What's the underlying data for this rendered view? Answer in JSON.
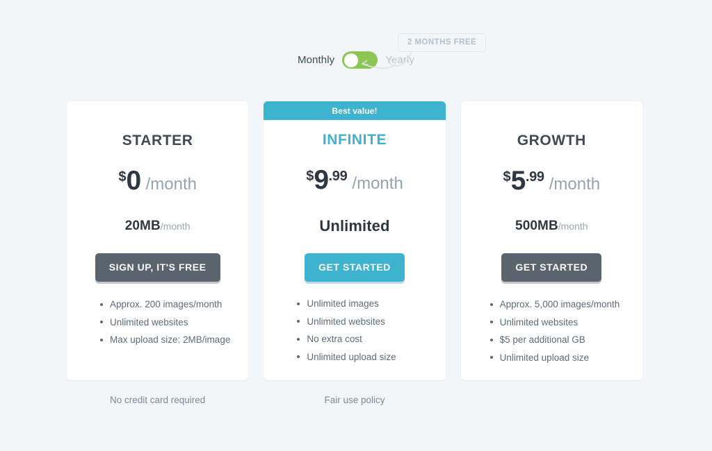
{
  "billing": {
    "monthly_label": "Monthly",
    "yearly_label": "Yearly",
    "selected": "Monthly",
    "promo_badge": "2 MONTHS FREE",
    "toggle_color": "#8cc653",
    "knob_color": "#ffffff"
  },
  "theme": {
    "page_background": "#f2f6f9",
    "accent": "#3eb3d0",
    "dark_button": "#59646f",
    "heading": "#3f4a57",
    "muted_text": "#94a3b0"
  },
  "plans": [
    {
      "id": "starter",
      "name": "STARTER",
      "ribbon": null,
      "price": {
        "currency": "$",
        "amount": "0",
        "cents": "",
        "period": "/month"
      },
      "storage": {
        "value": "20MB",
        "unit": "/month"
      },
      "cta": "SIGN UP, IT'S FREE",
      "cta_style": "dark",
      "features": [
        "Approx. 200 images/month",
        "Unlimited websites",
        "Max upload size: 2MB/image"
      ],
      "footnote": "No credit card required"
    },
    {
      "id": "infinite",
      "name": "INFINITE",
      "ribbon": "Best value!",
      "price": {
        "currency": "$",
        "amount": "9",
        "cents": ".99",
        "period": "/month"
      },
      "storage": {
        "value": "Unlimited",
        "unit": ""
      },
      "cta": "GET STARTED",
      "cta_style": "teal",
      "features": [
        "Unlimited images",
        "Unlimited websites",
        "No extra cost",
        "Unlimited upload size"
      ],
      "footnote": "Fair use policy"
    },
    {
      "id": "growth",
      "name": "GROWTH",
      "ribbon": null,
      "price": {
        "currency": "$",
        "amount": "5",
        "cents": ".99",
        "period": "/month"
      },
      "storage": {
        "value": "500MB",
        "unit": "/month"
      },
      "cta": "GET STARTED",
      "cta_style": "dark",
      "features": [
        "Approx. 5,000 images/month",
        "Unlimited websites",
        "$5 per additional GB",
        "Unlimited upload size"
      ],
      "footnote": ""
    }
  ]
}
